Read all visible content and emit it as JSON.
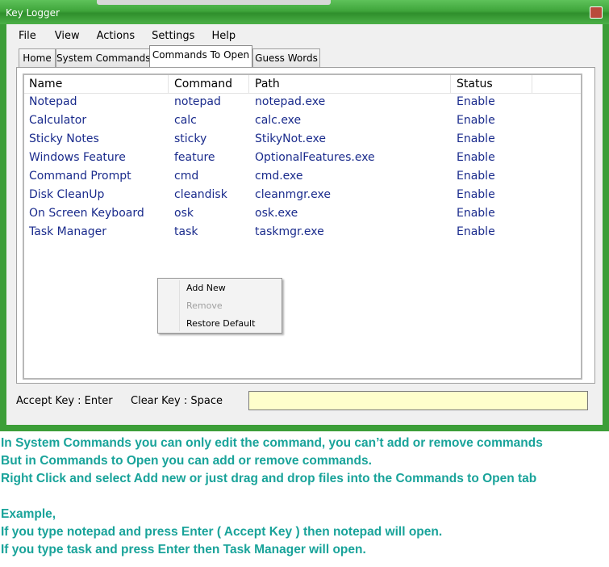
{
  "window": {
    "title": "Key Logger"
  },
  "menu": [
    "File",
    "View",
    "Actions",
    "Settings",
    "Help"
  ],
  "tabs": [
    {
      "label": "Home",
      "active": false
    },
    {
      "label": "System Commands",
      "active": false
    },
    {
      "label": "Commands To Open",
      "active": true
    },
    {
      "label": "Guess Words",
      "active": false
    }
  ],
  "table": {
    "columns": [
      "Name",
      "Command",
      "Path",
      "Status"
    ],
    "rows": [
      {
        "name": "Notepad",
        "command": "notepad",
        "path": "notepad.exe",
        "status": "Enable"
      },
      {
        "name": "Calculator",
        "command": "calc",
        "path": "calc.exe",
        "status": "Enable"
      },
      {
        "name": "Sticky Notes",
        "command": "sticky",
        "path": "StikyNot.exe",
        "status": "Enable"
      },
      {
        "name": "Windows Feature",
        "command": "feature",
        "path": "OptionalFeatures.exe",
        "status": "Enable"
      },
      {
        "name": "Command Prompt",
        "command": "cmd",
        "path": "cmd.exe",
        "status": "Enable"
      },
      {
        "name": "Disk CleanUp",
        "command": "cleandisk",
        "path": "cleanmgr.exe",
        "status": "Enable"
      },
      {
        "name": "On Screen Keyboard",
        "command": "osk",
        "path": "osk.exe",
        "status": "Enable"
      },
      {
        "name": "Task Manager",
        "command": "task",
        "path": "taskmgr.exe",
        "status": "Enable"
      }
    ]
  },
  "context_menu": [
    {
      "label": "Add New",
      "enabled": true
    },
    {
      "label": "Remove",
      "enabled": false
    },
    {
      "label": "Restore Default",
      "enabled": true
    }
  ],
  "status": {
    "accept_key": "Accept Key : Enter",
    "clear_key": "Clear Key : Space",
    "input_value": ""
  },
  "notes": [
    "In System Commands you can only edit the command, you can’t add or remove commands",
    "But in Commands to Open you can add or remove commands.",
    "Right Click and select Add new or just drag and drop files into the Commands to Open tab",
    "",
    "Example,",
    "If you type notepad and press Enter ( Accept Key ) then notepad will open.",
    "If you type task and press Enter then Task Manager will open."
  ],
  "colors": {
    "title_bar": "#3fa53b",
    "row_text": "#1a2b8c",
    "notes_text": "#19a39a",
    "input_bg": "#ffffcc"
  }
}
